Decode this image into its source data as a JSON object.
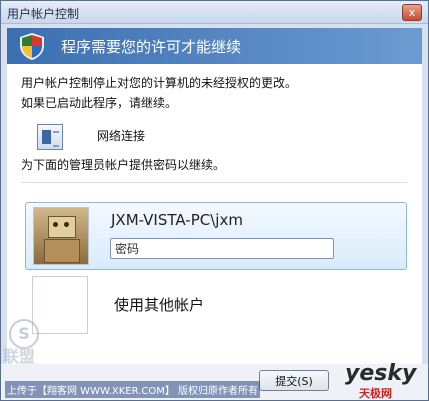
{
  "window": {
    "title": "用户帐户控制",
    "close_glyph": "x"
  },
  "banner": {
    "text": "程序需要您的许可才能继续"
  },
  "message": {
    "line1": "用户帐户控制停止对您的计算机的未经授权的更改。",
    "line2": "如果已启动此程序，请继续。"
  },
  "program": {
    "name": "网络连接",
    "icon": "network-connections-icon"
  },
  "instruction": "为下面的管理员帐户提供密码以继续。",
  "accounts": [
    {
      "name": "JXM-VISTA-PC\\jxm",
      "password_placeholder": "密码",
      "avatar": "robot-avatar"
    },
    {
      "name": "使用其他帐户",
      "avatar": "blank-avatar"
    }
  ],
  "footer": {
    "submit_label": "提交(S)"
  },
  "watermark": {
    "text": "上传于【翔客网 WWW.XKER.COM】 版权归原作者所有"
  },
  "logo": {
    "text": "yesky",
    "sub": "天极网"
  },
  "stamp": {
    "text": "联盟"
  },
  "colors": {
    "banner": "#3c6fb0",
    "accent": "#8fb8e0"
  }
}
